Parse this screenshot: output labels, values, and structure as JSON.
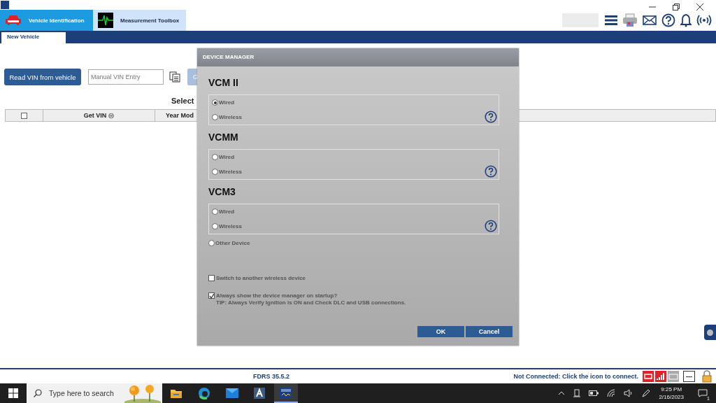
{
  "app_tabs": [
    {
      "label": "Vehicle Identification",
      "selected": true
    },
    {
      "label": "Measurement Toolbox",
      "selected": false
    }
  ],
  "sub_tabs": [
    {
      "label": "New Vehicle",
      "selected": true
    }
  ],
  "read_vin_button": "Read VIN from vehicle",
  "vin_field": {
    "placeholder": "Manual VIN Entry"
  },
  "go_button": "G",
  "select_heading": "Select",
  "table": {
    "columns": [
      {
        "kind": "checkbox",
        "checked": false
      },
      {
        "kind": "sortable",
        "label": "Get VIN"
      },
      {
        "kind": "text",
        "label": "Year Mod"
      }
    ]
  },
  "dialog": {
    "title": "DEVICE MANAGER",
    "sections": [
      {
        "title": "VCM II",
        "options": [
          {
            "label": "Wired",
            "selected": true
          },
          {
            "label": "Wireless",
            "selected": false
          }
        ]
      },
      {
        "title": "VCMM",
        "options": [
          {
            "label": "Wired",
            "selected": false
          },
          {
            "label": "Wireless",
            "selected": false
          }
        ]
      },
      {
        "title": "VCM3",
        "options": [
          {
            "label": "Wired",
            "selected": false
          },
          {
            "label": "Wireless",
            "selected": false
          }
        ]
      }
    ],
    "other_device": {
      "label": "Other Device",
      "selected": false
    },
    "switch_device": {
      "label": "Switch to another wireless device",
      "checked": false
    },
    "startup": {
      "label": "Always show the device manager on startup?",
      "checked": true,
      "tip": "TIP: Always Verify Ignition is ON and Check DLC and USB connections."
    },
    "buttons": [
      "OK",
      "Cancel"
    ]
  },
  "status_bar": {
    "version": "FDRS 35.5.2",
    "connection": "Not Connected: Click the icon to connect.",
    "indicator": "---"
  },
  "taskbar": {
    "search": {
      "placeholder": "Type here to search"
    },
    "time": "9:25 PM",
    "date": "2/16/2023",
    "notifications": "1"
  }
}
